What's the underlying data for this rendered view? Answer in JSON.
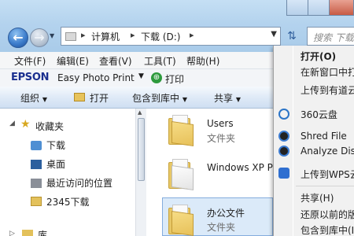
{
  "address_bar": {
    "breadcrumbs": [
      "计算机",
      "下载 (D:)"
    ],
    "separator": "▸"
  },
  "search": {
    "placeholder": "搜索 下载"
  },
  "menu_bar": {
    "items": [
      "文件(F)",
      "编辑(E)",
      "查看(V)",
      "工具(T)",
      "帮助(H)"
    ]
  },
  "epson_bar": {
    "brand": "EPSON",
    "app": "Easy Photo Print",
    "print_label": "打印"
  },
  "command_bar": {
    "items": [
      "组织",
      "打开",
      "包含到库中",
      "共享"
    ]
  },
  "nav_pane": {
    "favorites_label": "收藏夹",
    "items": [
      "下载",
      "桌面",
      "最近访问的位置",
      "2345下载"
    ],
    "library_label": "库"
  },
  "files": [
    {
      "name": "Users",
      "type": "文件夹"
    },
    {
      "name": "Windows XP P",
      "type": ""
    },
    {
      "name": "办公文件",
      "type": "文件夹"
    }
  ],
  "context_menu": {
    "items": [
      {
        "label": "打开(O)",
        "bold": true
      },
      {
        "label": "在新窗口中打"
      },
      {
        "label": "上传到有道云"
      },
      {
        "label": "360云盘"
      },
      {
        "label": "Shred File"
      },
      {
        "label": "Analyze Disk"
      },
      {
        "label": "上传到WPS云"
      },
      {
        "label": "共享(H)"
      },
      {
        "label": "还原以前的版"
      },
      {
        "label": "包含到库中(I"
      }
    ]
  },
  "colors": {
    "title_bg": "#b4d3ee",
    "epson_brand": "#1a2f8f",
    "selection": "#dbeaf9",
    "folder_yellow": "#e7c766"
  }
}
